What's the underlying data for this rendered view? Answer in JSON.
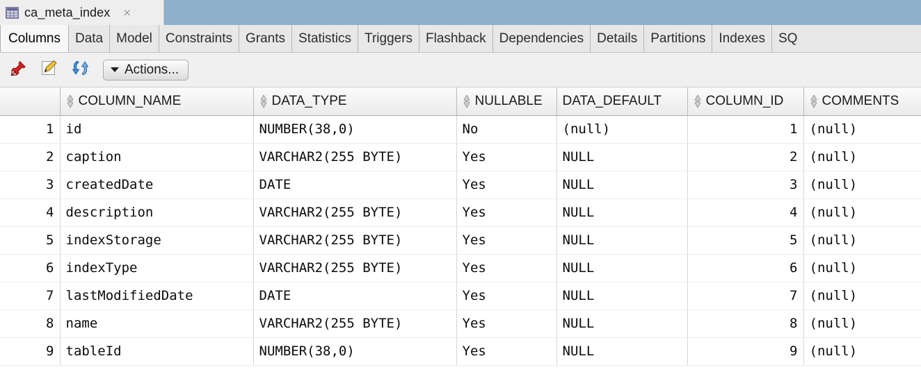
{
  "window": {
    "tab": {
      "icon": "table-grid-icon",
      "label": "ca_meta_index",
      "close": "×"
    },
    "tabstrip_bg": "#8fb0cc"
  },
  "subtabs": {
    "active": "Columns",
    "items": [
      {
        "label": "Columns"
      },
      {
        "label": "Data"
      },
      {
        "label": "Model"
      },
      {
        "label": "Constraints"
      },
      {
        "label": "Grants"
      },
      {
        "label": "Statistics"
      },
      {
        "label": "Triggers"
      },
      {
        "label": "Flashback"
      },
      {
        "label": "Dependencies"
      },
      {
        "label": "Details"
      },
      {
        "label": "Partitions"
      },
      {
        "label": "Indexes"
      },
      {
        "label": "SQ"
      }
    ]
  },
  "toolbar": {
    "pin_icon": "pushpin-icon",
    "edit_icon": "edit-pencil-icon",
    "refresh_icon": "refresh-icon",
    "actions_label": "Actions...",
    "actions_caret": "chevron-down-icon"
  },
  "grid": {
    "columns": [
      {
        "key": "rownum",
        "label": "",
        "sortable": false
      },
      {
        "key": "COLUMN_NAME",
        "label": "COLUMN_NAME",
        "sortable": true
      },
      {
        "key": "DATA_TYPE",
        "label": "DATA_TYPE",
        "sortable": true
      },
      {
        "key": "NULLABLE",
        "label": "NULLABLE",
        "sortable": true
      },
      {
        "key": "DATA_DEFAULT",
        "label": "DATA_DEFAULT",
        "sortable": false
      },
      {
        "key": "COLUMN_ID",
        "label": "COLUMN_ID",
        "sortable": true
      },
      {
        "key": "COMMENTS",
        "label": "COMMENTS",
        "sortable": true
      }
    ],
    "rows": [
      {
        "rownum": "1",
        "COLUMN_NAME": "id",
        "DATA_TYPE": "NUMBER(38,0)",
        "NULLABLE": "No",
        "DATA_DEFAULT": "(null)",
        "COLUMN_ID": "1",
        "COMMENTS": "(null)"
      },
      {
        "rownum": "2",
        "COLUMN_NAME": "caption",
        "DATA_TYPE": "VARCHAR2(255 BYTE)",
        "NULLABLE": "Yes",
        "DATA_DEFAULT": "NULL",
        "COLUMN_ID": "2",
        "COMMENTS": "(null)"
      },
      {
        "rownum": "3",
        "COLUMN_NAME": "createdDate",
        "DATA_TYPE": "DATE",
        "NULLABLE": "Yes",
        "DATA_DEFAULT": "NULL",
        "COLUMN_ID": "3",
        "COMMENTS": "(null)"
      },
      {
        "rownum": "4",
        "COLUMN_NAME": "description",
        "DATA_TYPE": "VARCHAR2(255 BYTE)",
        "NULLABLE": "Yes",
        "DATA_DEFAULT": "NULL",
        "COLUMN_ID": "4",
        "COMMENTS": "(null)"
      },
      {
        "rownum": "5",
        "COLUMN_NAME": "indexStorage",
        "DATA_TYPE": "VARCHAR2(255 BYTE)",
        "NULLABLE": "Yes",
        "DATA_DEFAULT": "NULL",
        "COLUMN_ID": "5",
        "COMMENTS": "(null)"
      },
      {
        "rownum": "6",
        "COLUMN_NAME": "indexType",
        "DATA_TYPE": "VARCHAR2(255 BYTE)",
        "NULLABLE": "Yes",
        "DATA_DEFAULT": "NULL",
        "COLUMN_ID": "6",
        "COMMENTS": "(null)"
      },
      {
        "rownum": "7",
        "COLUMN_NAME": "lastModifiedDate",
        "DATA_TYPE": "DATE",
        "NULLABLE": "Yes",
        "DATA_DEFAULT": "NULL",
        "COLUMN_ID": "7",
        "COMMENTS": "(null)"
      },
      {
        "rownum": "8",
        "COLUMN_NAME": "name",
        "DATA_TYPE": "VARCHAR2(255 BYTE)",
        "NULLABLE": "Yes",
        "DATA_DEFAULT": "NULL",
        "COLUMN_ID": "8",
        "COMMENTS": "(null)"
      },
      {
        "rownum": "9",
        "COLUMN_NAME": "tableId",
        "DATA_TYPE": "NUMBER(38,0)",
        "NULLABLE": "Yes",
        "DATA_DEFAULT": "NULL",
        "COLUMN_ID": "9",
        "COMMENTS": "(null)"
      }
    ]
  }
}
